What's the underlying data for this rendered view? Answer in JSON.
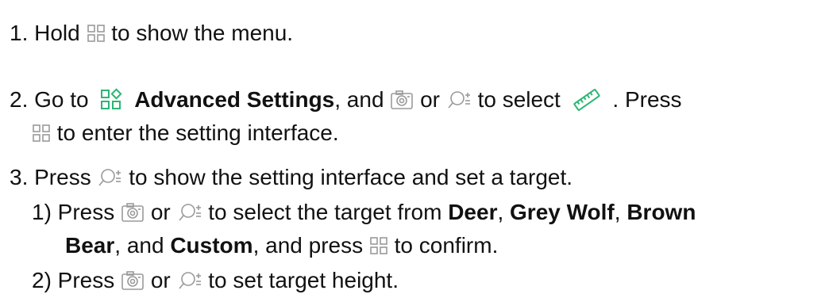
{
  "colors": {
    "text": "#111111",
    "icon_gray": "#9a9a9a",
    "accent": "#2bb673"
  },
  "icons": {
    "menu": "menu-grid-icon",
    "advanced": "advanced-settings-icon",
    "camera": "camera-icon",
    "zoom": "zoom-plus-minus-icon",
    "ruler": "ruler-icon"
  },
  "steps": {
    "s1": {
      "pre": "1. Hold",
      "post": "to show the menu."
    },
    "s2": {
      "pre": "2. Go to",
      "bold": "Advanced Settings",
      "after_bold": ", and",
      "or": "or",
      "to_select": "to select",
      "press": ". Press",
      "cont": "to enter the setting interface."
    },
    "s3": {
      "pre": "3. Press",
      "post": "to show the setting interface and set a target."
    },
    "s3_1": {
      "pre": "1) Press",
      "or": "or",
      "mid": "to select the target from",
      "deer": "Deer",
      "comma1": ",",
      "grey_wolf": "Grey Wolf",
      "comma2": ",",
      "brown": "Brown",
      "bear": "Bear",
      "and": ", and",
      "custom": "Custom",
      "press_end": ", and press",
      "confirm": "to confirm."
    },
    "s3_2": {
      "pre": "2) Press",
      "or": "or",
      "post": "to set target height."
    }
  }
}
